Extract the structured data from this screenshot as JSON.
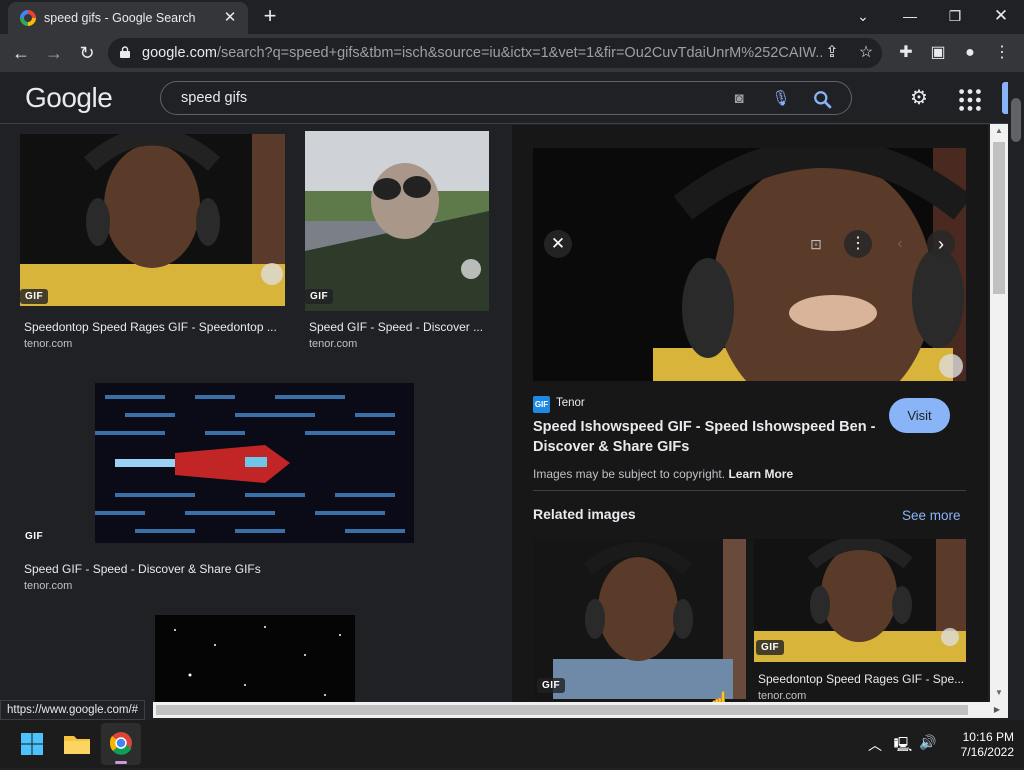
{
  "browser": {
    "tab_title": "speed gifs - Google Search",
    "url_host": "google.com",
    "url_rest": "/search?q=speed+gifs&tbm=isch&source=iu&ictx=1&vet=1&fir=Ou2CuvTdaiUnrM%252CAIW...",
    "status_url": "https://www.google.com/#"
  },
  "google": {
    "logo": "Google",
    "query": "speed gifs"
  },
  "results": [
    {
      "title": "Speedontop Speed Rages GIF - Speedontop ...",
      "source": "tenor.com",
      "badge": "GIF"
    },
    {
      "title": "Speed GIF - Speed - Discover ...",
      "source": "tenor.com",
      "badge": "GIF"
    },
    {
      "title": "Speed GIF - Speed - Discover & Share GIFs",
      "source": "tenor.com",
      "badge": "GIF"
    }
  ],
  "panel": {
    "source_name": "Tenor",
    "source_icon_text": "GIF",
    "title": "Speed Ishowspeed GIF - Speed Ishowspeed Ben - Discover & Share GIFs",
    "visit_label": "Visit",
    "copyright": "Images may be subject to copyright.",
    "learn_more": "Learn More",
    "related_label": "Related images",
    "see_more": "See more",
    "related": [
      {
        "badge": "GIF",
        "title": "",
        "source": ""
      },
      {
        "badge": "GIF",
        "title": "Speedontop Speed Rages GIF - Spe...",
        "source": "tenor.com"
      }
    ]
  },
  "taskbar": {
    "time": "10:16 PM",
    "date": "7/16/2022"
  },
  "colors": {
    "accent": "#8ab4f8",
    "background": "#202124",
    "panel": "#171717"
  }
}
